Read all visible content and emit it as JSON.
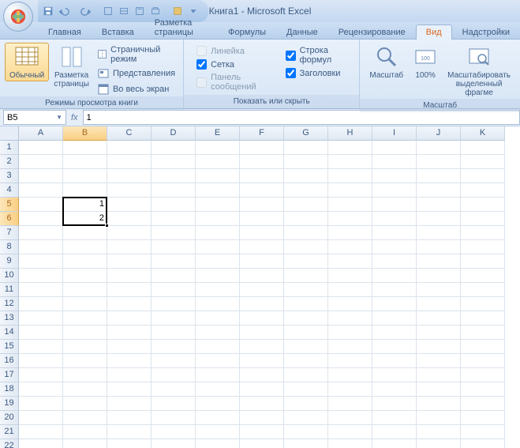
{
  "title": "Книга1 - Microsoft Excel",
  "qat_icons": [
    "save-icon",
    "undo-icon",
    "redo-icon",
    "print-icon",
    "preview-icon",
    "open-icon",
    "new-icon",
    "sep",
    "quick-icon",
    "sep",
    "more-icon"
  ],
  "tabs": [
    "Главная",
    "Вставка",
    "Разметка страницы",
    "Формулы",
    "Данные",
    "Рецензирование",
    "Вид",
    "Надстройки"
  ],
  "active_tab": 6,
  "ribbon": {
    "views": {
      "normal": "Обычный",
      "page_layout": "Разметка\nстраницы",
      "page_break": "Страничный режим",
      "custom_views": "Представления",
      "full_screen": "Во весь экран",
      "group_label": "Режимы просмотра книги"
    },
    "show": {
      "ruler": "Линейка",
      "gridlines": "Сетка",
      "messages": "Панель сообщений",
      "formula_bar": "Строка формул",
      "headings": "Заголовки",
      "group_label": "Показать или скрыть"
    },
    "zoom": {
      "zoom": "Масштаб",
      "hundred": "100%",
      "selection": "Масштабировать\nвыделенный фрагме",
      "group_label": "Масштаб"
    }
  },
  "checks": {
    "ruler": false,
    "gridlines": true,
    "messages": false,
    "formula_bar": true,
    "headings": true
  },
  "name_box": "B5",
  "formula_value": "1",
  "columns": [
    "A",
    "B",
    "C",
    "D",
    "E",
    "F",
    "G",
    "H",
    "I",
    "J",
    "K"
  ],
  "rows": 22,
  "selected_col": "B",
  "selected_rows": [
    5,
    6
  ],
  "cells": {
    "B5": "1",
    "B6": "2"
  },
  "chart_data": {
    "type": "table",
    "selection": "B5:B6",
    "active_cell": "B5",
    "values": [
      [
        "1"
      ],
      [
        "2"
      ]
    ]
  }
}
